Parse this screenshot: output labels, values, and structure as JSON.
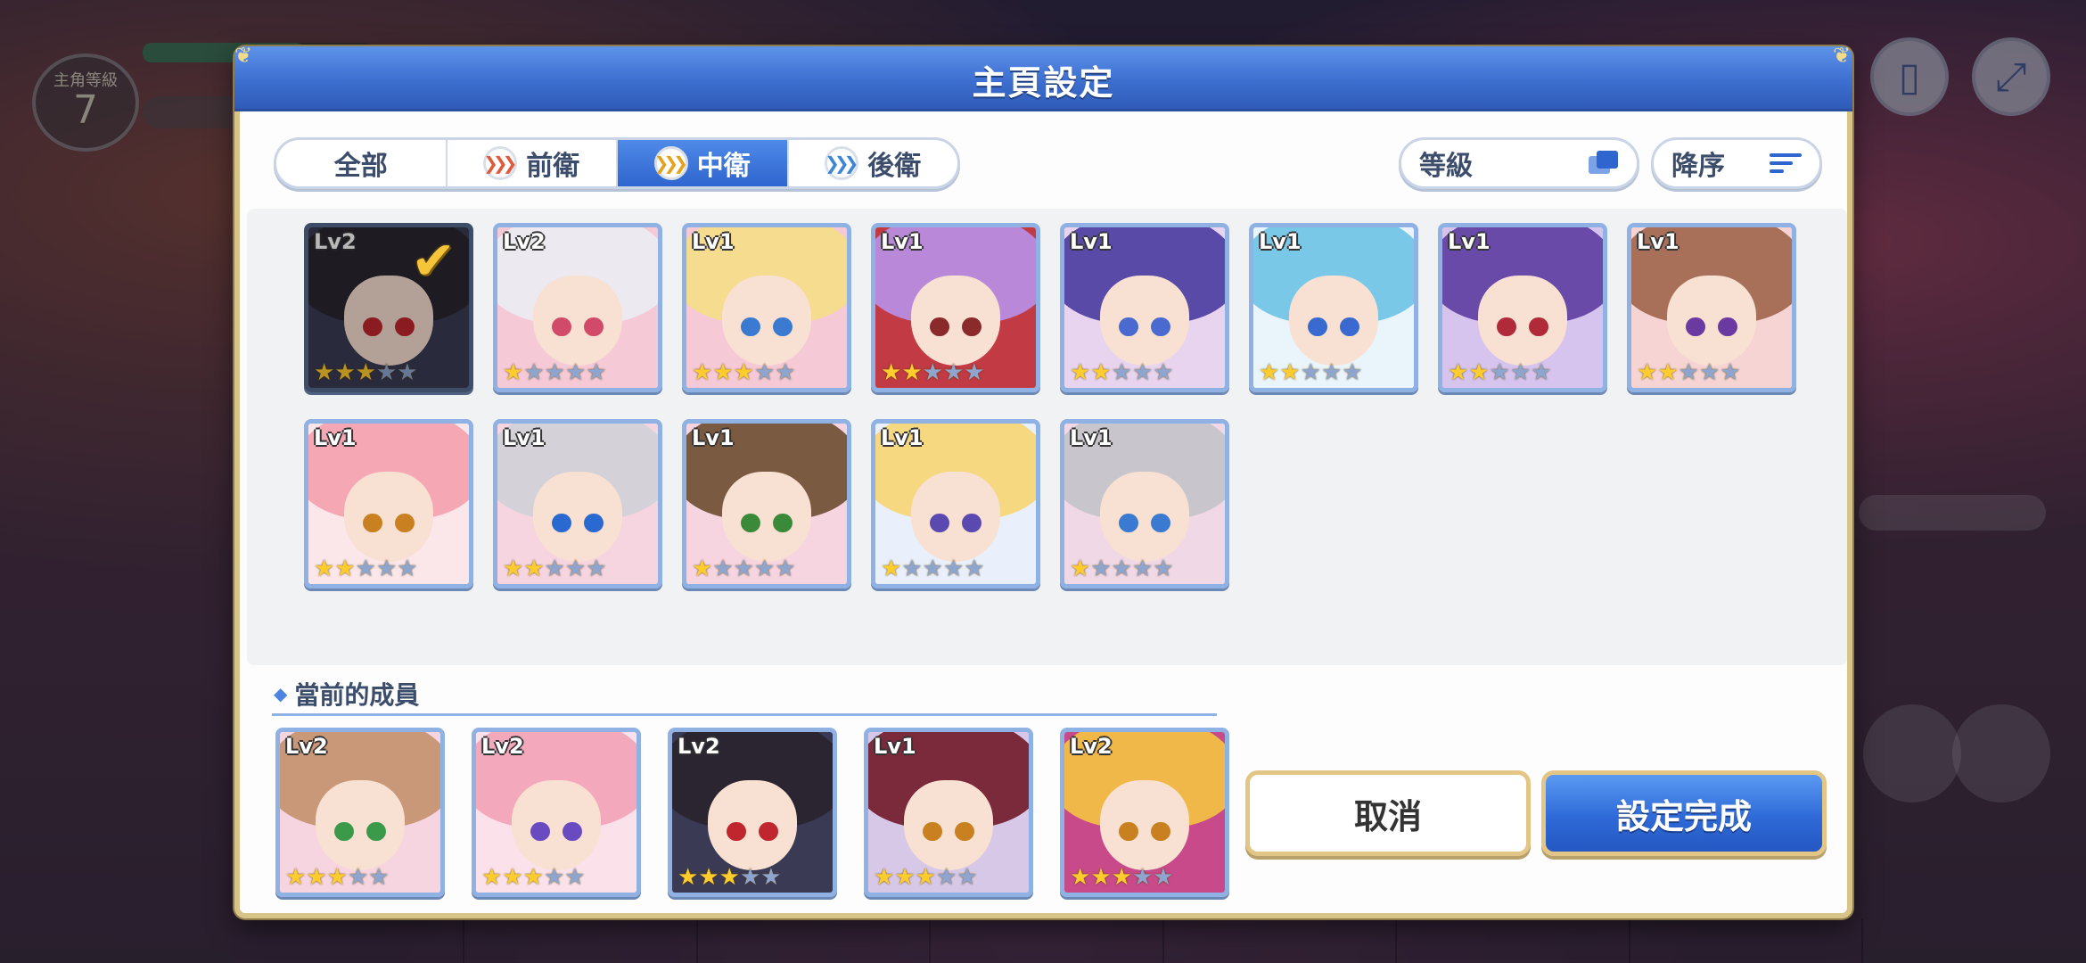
{
  "background": {
    "rank_label": "主角等級",
    "rank_value": "7"
  },
  "dialog": {
    "title": "主頁設定",
    "tabs": [
      {
        "label": "全部",
        "icon": "none"
      },
      {
        "label": "前衛",
        "icon": "front-position-icon"
      },
      {
        "label": "中衛",
        "icon": "middle-position-icon"
      },
      {
        "label": "後衛",
        "icon": "back-position-icon"
      }
    ],
    "active_tab": "中衛",
    "sort": {
      "key_label": "等級",
      "order_label": "降序"
    },
    "roster": [
      {
        "level": "Lv2",
        "stars": 3,
        "selected": true,
        "hair": "#2a2530",
        "bg": "#3a3a55",
        "eye": "#c0262e"
      },
      {
        "level": "Lv2",
        "stars": 1,
        "selected": false,
        "hair": "#eceaf0",
        "bg": "#f6c9d6",
        "eye": "#d24a6a"
      },
      {
        "level": "Lv1",
        "stars": 3,
        "selected": false,
        "hair": "#f5dc8e",
        "bg": "#f6c9d6",
        "eye": "#3a7ad0"
      },
      {
        "level": "Lv1",
        "stars": 2,
        "selected": false,
        "hair": "#b988d8",
        "bg": "#c23a44",
        "eye": "#8a2a2a"
      },
      {
        "level": "Lv1",
        "stars": 2,
        "selected": false,
        "hair": "#5a4aa8",
        "bg": "#e9d4f0",
        "eye": "#4a6ad0"
      },
      {
        "level": "Lv1",
        "stars": 2,
        "selected": false,
        "hair": "#7ac8e8",
        "bg": "#eaf4fb",
        "eye": "#3a6ad0"
      },
      {
        "level": "Lv1",
        "stars": 2,
        "selected": false,
        "hair": "#6a4aa8",
        "bg": "#d7c4ee",
        "eye": "#b02a3a"
      },
      {
        "level": "Lv1",
        "stars": 2,
        "selected": false,
        "hair": "#a87058",
        "bg": "#f6d4d4",
        "eye": "#6a3aa0"
      },
      {
        "level": "Lv1",
        "stars": 2,
        "selected": false,
        "hair": "#f5a8b4",
        "bg": "#fbe6ea",
        "eye": "#c88020"
      },
      {
        "level": "Lv1",
        "stars": 2,
        "selected": false,
        "hair": "#d4d2d8",
        "bg": "#f6d4e0",
        "eye": "#2a6ad0"
      },
      {
        "level": "Lv1",
        "stars": 1,
        "selected": false,
        "hair": "#7a5a40",
        "bg": "#f6d4e0",
        "eye": "#3a8a3a"
      },
      {
        "level": "Lv1",
        "stars": 1,
        "selected": false,
        "hair": "#f5d880",
        "bg": "#eaf0fb",
        "eye": "#5a4ab0"
      },
      {
        "level": "Lv1",
        "stars": 1,
        "selected": false,
        "hair": "#c8c6cc",
        "bg": "#f0d8e6",
        "eye": "#3a7ad0"
      }
    ],
    "current_label": "當前的成員",
    "current_members": [
      {
        "level": "Lv2",
        "stars": 3,
        "hair": "#c89878",
        "bg": "#f6d4e0",
        "eye": "#3a9a4a"
      },
      {
        "level": "Lv2",
        "stars": 3,
        "hair": "#f3a8bc",
        "bg": "#fbe2ea",
        "eye": "#6a4ac0"
      },
      {
        "level": "Lv2",
        "stars": 3,
        "hair": "#2a2530",
        "bg": "#3a3a55",
        "eye": "#c0262e"
      },
      {
        "level": "Lv1",
        "stars": 3,
        "hair": "#7a2a3a",
        "bg": "#d8c8e8",
        "eye": "#c88020"
      },
      {
        "level": "Lv2",
        "stars": 3,
        "hair": "#f0b848",
        "bg": "#c84a8a",
        "eye": "#c88020"
      }
    ],
    "cancel_label": "取消",
    "confirm_label": "設定完成"
  },
  "colors": {
    "accent": "#2f65cf",
    "gold": "#e3c585",
    "star": "#ffcc2e"
  }
}
